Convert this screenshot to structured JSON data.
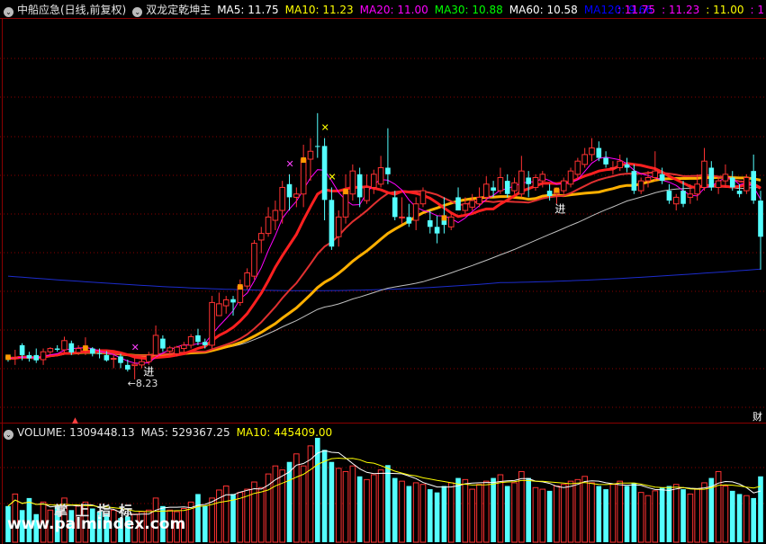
{
  "header": {
    "stock": "中船应急(日线,前复权)",
    "indicator": "双龙定乾坤主",
    "ma": [
      {
        "label": "MA5: 11.75",
        "color": "#ffffff"
      },
      {
        "label": "MA10: 11.23",
        "color": "#ffff00"
      },
      {
        "label": "MA20: 11.00",
        "color": "#ff00ff"
      },
      {
        "label": "MA30: 10.88",
        "color": "#00ff00"
      },
      {
        "label": "MA60: 10.58",
        "color": "#ffffff"
      },
      {
        "label": "MA120: 9.66",
        "color": "#0000ff"
      }
    ],
    "right": [
      {
        "label": ": 11.75",
        "color": "#ff00ff"
      },
      {
        "label": ": 11.23",
        "color": "#ff00ff"
      },
      {
        "label": ": 11.00",
        "color": "#ffff00"
      },
      {
        "label": ": 1",
        "color": "#ff00ff"
      }
    ]
  },
  "volume_header": {
    "volume": "VOLUME: 1309448.13",
    "ma5": "MA5: 529367.25",
    "ma10": "MA10: 445409.00"
  },
  "annotations": {
    "low_price": "←8.23",
    "buy_signal_1": "进",
    "buy_signal_2": "进",
    "corner": "财"
  },
  "watermark": {
    "cn": "掌上指标",
    "url": "www.palmindex.com"
  },
  "colors": {
    "up": "#ff3232",
    "down": "#54ffff",
    "grid": "#8a0000",
    "ma120": "#1c2ccc"
  },
  "chart_data": {
    "type": "candlestick",
    "candles": [
      {
        "o": 8.98,
        "h": 9.0,
        "l": 8.9,
        "c": 8.95,
        "tag": "o"
      },
      {
        "o": 8.95,
        "h": 9.08,
        "l": 8.85,
        "c": 8.96
      },
      {
        "o": 9.15,
        "h": 9.18,
        "l": 8.92,
        "c": 9.0
      },
      {
        "o": 9.0,
        "h": 9.05,
        "l": 8.9,
        "c": 8.95
      },
      {
        "o": 9.0,
        "h": 9.1,
        "l": 8.88,
        "c": 8.92
      },
      {
        "o": 8.93,
        "h": 9.1,
        "l": 8.85,
        "c": 9.05
      },
      {
        "o": 9.05,
        "h": 9.12,
        "l": 9.0,
        "c": 9.1
      },
      {
        "o": 9.1,
        "h": 9.15,
        "l": 9.05,
        "c": 9.08
      },
      {
        "o": 9.08,
        "h": 9.28,
        "l": 9.04,
        "c": 9.22
      },
      {
        "o": 9.18,
        "h": 9.22,
        "l": 9.0,
        "c": 9.04
      },
      {
        "o": 9.04,
        "h": 9.15,
        "l": 9.0,
        "c": 9.1
      },
      {
        "o": 9.12,
        "h": 9.27,
        "l": 9.0,
        "c": 9.12,
        "tag": "o"
      },
      {
        "o": 9.1,
        "h": 9.12,
        "l": 8.98,
        "c": 9.02
      },
      {
        "o": 9.03,
        "h": 9.1,
        "l": 8.95,
        "c": 9.02
      },
      {
        "o": 9.0,
        "h": 9.06,
        "l": 8.9,
        "c": 8.92
      },
      {
        "o": 8.95,
        "h": 9.0,
        "l": 8.8,
        "c": 8.95
      },
      {
        "o": 8.98,
        "h": 9.02,
        "l": 8.8,
        "c": 8.88
      },
      {
        "o": 8.85,
        "h": 8.93,
        "l": 8.75,
        "c": 8.78
      },
      {
        "o": 8.84,
        "h": 8.96,
        "l": 8.63,
        "c": 8.86,
        "tag": "x"
      },
      {
        "o": 8.85,
        "h": 8.95,
        "l": 8.8,
        "c": 8.9
      },
      {
        "o": 8.9,
        "h": 9.05,
        "l": 8.85,
        "c": 9.0
      },
      {
        "o": 9.0,
        "h": 9.45,
        "l": 8.95,
        "c": 9.3
      },
      {
        "o": 9.25,
        "h": 9.3,
        "l": 9.05,
        "c": 9.1
      },
      {
        "o": 9.06,
        "h": 9.14,
        "l": 8.98,
        "c": 9.11
      },
      {
        "o": 9.02,
        "h": 9.14,
        "l": 8.98,
        "c": 9.12
      },
      {
        "o": 9.1,
        "h": 9.2,
        "l": 9.05,
        "c": 9.15
      },
      {
        "o": 9.15,
        "h": 9.32,
        "l": 9.1,
        "c": 9.28
      },
      {
        "o": 9.3,
        "h": 9.4,
        "l": 9.15,
        "c": 9.2
      },
      {
        "o": 9.2,
        "h": 9.25,
        "l": 9.1,
        "c": 9.15
      },
      {
        "o": 9.15,
        "h": 9.9,
        "l": 9.1,
        "c": 9.8
      },
      {
        "o": 9.6,
        "h": 9.95,
        "l": 9.6,
        "c": 9.78
      },
      {
        "o": 9.75,
        "h": 9.9,
        "l": 9.63,
        "c": 9.84
      },
      {
        "o": 9.85,
        "h": 9.9,
        "l": 9.6,
        "c": 9.8
      },
      {
        "o": 9.8,
        "h": 10.15,
        "l": 9.75,
        "c": 10.05,
        "tag": "o"
      },
      {
        "o": 10.05,
        "h": 10.32,
        "l": 10.0,
        "c": 10.25
      },
      {
        "o": 10.2,
        "h": 10.75,
        "l": 10.15,
        "c": 10.7
      },
      {
        "o": 10.75,
        "h": 10.95,
        "l": 10.55,
        "c": 10.85
      },
      {
        "o": 10.85,
        "h": 11.25,
        "l": 10.8,
        "c": 11.1
      },
      {
        "o": 11.05,
        "h": 11.35,
        "l": 10.9,
        "c": 11.2
      },
      {
        "o": 11.2,
        "h": 11.65,
        "l": 11.0,
        "c": 11.55
      },
      {
        "o": 11.6,
        "h": 11.75,
        "l": 11.2,
        "c": 11.4,
        "tag": "x"
      },
      {
        "o": 11.4,
        "h": 11.55,
        "l": 11.25,
        "c": 11.45
      },
      {
        "o": 11.45,
        "h": 12.2,
        "l": 11.25,
        "c": 11.98,
        "tag": "o"
      },
      {
        "o": 11.98,
        "h": 12.3,
        "l": 11.65,
        "c": 12.1
      },
      {
        "o": 12.18,
        "h": 12.68,
        "l": 12.0,
        "c": 12.17
      },
      {
        "o": 12.18,
        "h": 12.3,
        "l": 11.05,
        "c": 11.36,
        "tag": "x"
      },
      {
        "o": 11.36,
        "h": 11.55,
        "l": 10.6,
        "c": 10.65,
        "tag": "x"
      },
      {
        "o": 10.8,
        "h": 11.2,
        "l": 10.65,
        "c": 11.1
      },
      {
        "o": 11.1,
        "h": 11.75,
        "l": 11.0,
        "c": 11.5,
        "tag": "o"
      },
      {
        "o": 11.45,
        "h": 11.9,
        "l": 11.35,
        "c": 11.8
      },
      {
        "o": 11.75,
        "h": 11.85,
        "l": 11.25,
        "c": 11.4
      },
      {
        "o": 11.35,
        "h": 11.75,
        "l": 11.3,
        "c": 11.55
      },
      {
        "o": 11.55,
        "h": 11.82,
        "l": 11.45,
        "c": 11.75
      },
      {
        "o": 11.6,
        "h": 12.03,
        "l": 11.55,
        "c": 11.85
      },
      {
        "o": 11.85,
        "h": 12.45,
        "l": 11.6,
        "c": 11.75
      },
      {
        "o": 11.4,
        "h": 11.5,
        "l": 11.05,
        "c": 11.1
      },
      {
        "o": 11.1,
        "h": 11.4,
        "l": 11.0,
        "c": 11.1
      },
      {
        "o": 11.1,
        "h": 11.3,
        "l": 10.95,
        "c": 11.0
      },
      {
        "o": 11.05,
        "h": 11.4,
        "l": 10.9,
        "c": 11.3
      },
      {
        "o": 11.3,
        "h": 11.55,
        "l": 11.25,
        "c": 11.5
      },
      {
        "o": 11.05,
        "h": 11.2,
        "l": 10.85,
        "c": 10.95
      },
      {
        "o": 10.95,
        "h": 11.12,
        "l": 10.7,
        "c": 10.85
      },
      {
        "o": 11.1,
        "h": 11.4,
        "l": 10.85,
        "c": 10.98,
        "tag": "o"
      },
      {
        "o": 10.95,
        "h": 11.15,
        "l": 10.9,
        "c": 11.1
      },
      {
        "o": 11.4,
        "h": 11.55,
        "l": 11.2,
        "c": 11.2
      },
      {
        "o": 11.2,
        "h": 11.4,
        "l": 11.15,
        "c": 11.3
      },
      {
        "o": 11.25,
        "h": 11.45,
        "l": 11.2,
        "c": 11.35
      },
      {
        "o": 11.3,
        "h": 11.55,
        "l": 11.25,
        "c": 11.4
      },
      {
        "o": 11.4,
        "h": 11.72,
        "l": 11.35,
        "c": 11.6
      },
      {
        "o": 11.55,
        "h": 11.65,
        "l": 11.4,
        "c": 11.5
      },
      {
        "o": 11.5,
        "h": 11.85,
        "l": 11.45,
        "c": 11.7
      },
      {
        "o": 11.65,
        "h": 11.75,
        "l": 11.4,
        "c": 11.45
      },
      {
        "o": 11.5,
        "h": 11.7,
        "l": 11.45,
        "c": 11.62
      },
      {
        "o": 11.45,
        "h": 12.03,
        "l": 11.4,
        "c": 11.8
      },
      {
        "o": 11.7,
        "h": 11.8,
        "l": 11.4,
        "c": 11.6
      },
      {
        "o": 11.55,
        "h": 11.75,
        "l": 11.5,
        "c": 11.7
      },
      {
        "o": 11.65,
        "h": 11.8,
        "l": 11.55,
        "c": 11.75
      },
      {
        "o": 11.5,
        "h": 11.6,
        "l": 11.35,
        "c": 11.42
      },
      {
        "o": 11.45,
        "h": 11.55,
        "l": 11.3,
        "c": 11.52,
        "tag": "o"
      },
      {
        "o": 11.5,
        "h": 11.7,
        "l": 11.45,
        "c": 11.65
      },
      {
        "o": 11.6,
        "h": 11.85,
        "l": 11.55,
        "c": 11.8
      },
      {
        "o": 11.75,
        "h": 12.0,
        "l": 11.7,
        "c": 11.95
      },
      {
        "o": 11.9,
        "h": 12.15,
        "l": 11.85,
        "c": 12.05
      },
      {
        "o": 12.05,
        "h": 12.3,
        "l": 11.95,
        "c": 12.15
      },
      {
        "o": 12.15,
        "h": 12.25,
        "l": 11.95,
        "c": 12.0
      },
      {
        "o": 12.0,
        "h": 12.1,
        "l": 11.85,
        "c": 11.9
      },
      {
        "o": 11.85,
        "h": 11.95,
        "l": 11.75,
        "c": 11.85
      },
      {
        "o": 11.85,
        "h": 12.05,
        "l": 11.8,
        "c": 11.95
      },
      {
        "o": 11.9,
        "h": 12.0,
        "l": 11.78,
        "c": 11.85
      },
      {
        "o": 11.8,
        "h": 11.9,
        "l": 11.45,
        "c": 11.5
      },
      {
        "o": 11.5,
        "h": 11.7,
        "l": 11.45,
        "c": 11.65
      },
      {
        "o": 11.65,
        "h": 11.8,
        "l": 11.55,
        "c": 11.7
      },
      {
        "o": 11.7,
        "h": 12.1,
        "l": 11.65,
        "c": 11.8
      },
      {
        "o": 11.75,
        "h": 11.85,
        "l": 11.6,
        "c": 11.65
      },
      {
        "o": 11.5,
        "h": 11.6,
        "l": 11.3,
        "c": 11.35
      },
      {
        "o": 11.3,
        "h": 11.45,
        "l": 11.2,
        "c": 11.4
      },
      {
        "o": 11.5,
        "h": 11.65,
        "l": 11.25,
        "c": 11.3
      },
      {
        "o": 11.4,
        "h": 11.6,
        "l": 11.3,
        "c": 11.45
      },
      {
        "o": 11.45,
        "h": 11.75,
        "l": 11.35,
        "c": 11.6
      },
      {
        "o": 11.55,
        "h": 12.15,
        "l": 11.5,
        "c": 11.95
      },
      {
        "o": 11.85,
        "h": 11.95,
        "l": 11.5,
        "c": 11.55
      },
      {
        "o": 11.55,
        "h": 11.7,
        "l": 11.45,
        "c": 11.65
      },
      {
        "o": 11.65,
        "h": 11.9,
        "l": 11.55,
        "c": 11.75
      },
      {
        "o": 11.7,
        "h": 11.8,
        "l": 11.5,
        "c": 11.55
      },
      {
        "o": 11.5,
        "h": 11.6,
        "l": 11.4,
        "c": 11.45
      },
      {
        "o": 11.5,
        "h": 11.75,
        "l": 11.45,
        "c": 11.7
      },
      {
        "o": 11.8,
        "h": 12.05,
        "l": 11.3,
        "c": 11.35
      },
      {
        "o": 11.35,
        "h": 11.5,
        "l": 10.3,
        "c": 10.8
      }
    ],
    "volume": [
      45,
      60,
      40,
      55,
      35,
      50,
      40,
      45,
      55,
      40,
      45,
      50,
      42,
      38,
      35,
      40,
      30,
      32,
      35,
      38,
      40,
      55,
      45,
      40,
      38,
      42,
      50,
      60,
      45,
      55,
      65,
      70,
      60,
      62,
      66,
      75,
      68,
      85,
      95,
      90,
      100,
      110,
      95,
      120,
      130,
      115,
      100,
      92,
      88,
      95,
      82,
      78,
      84,
      90,
      96,
      80,
      76,
      70,
      74,
      72,
      66,
      62,
      70,
      74,
      80,
      78,
      66,
      72,
      76,
      80,
      84,
      70,
      74,
      88,
      80,
      68,
      66,
      64,
      70,
      72,
      76,
      78,
      82,
      74,
      70,
      66,
      72,
      76,
      70,
      74,
      62,
      58,
      64,
      68,
      70,
      72,
      66,
      60,
      66,
      74,
      80,
      88,
      70,
      64,
      60,
      58,
      55,
      82
    ]
  }
}
